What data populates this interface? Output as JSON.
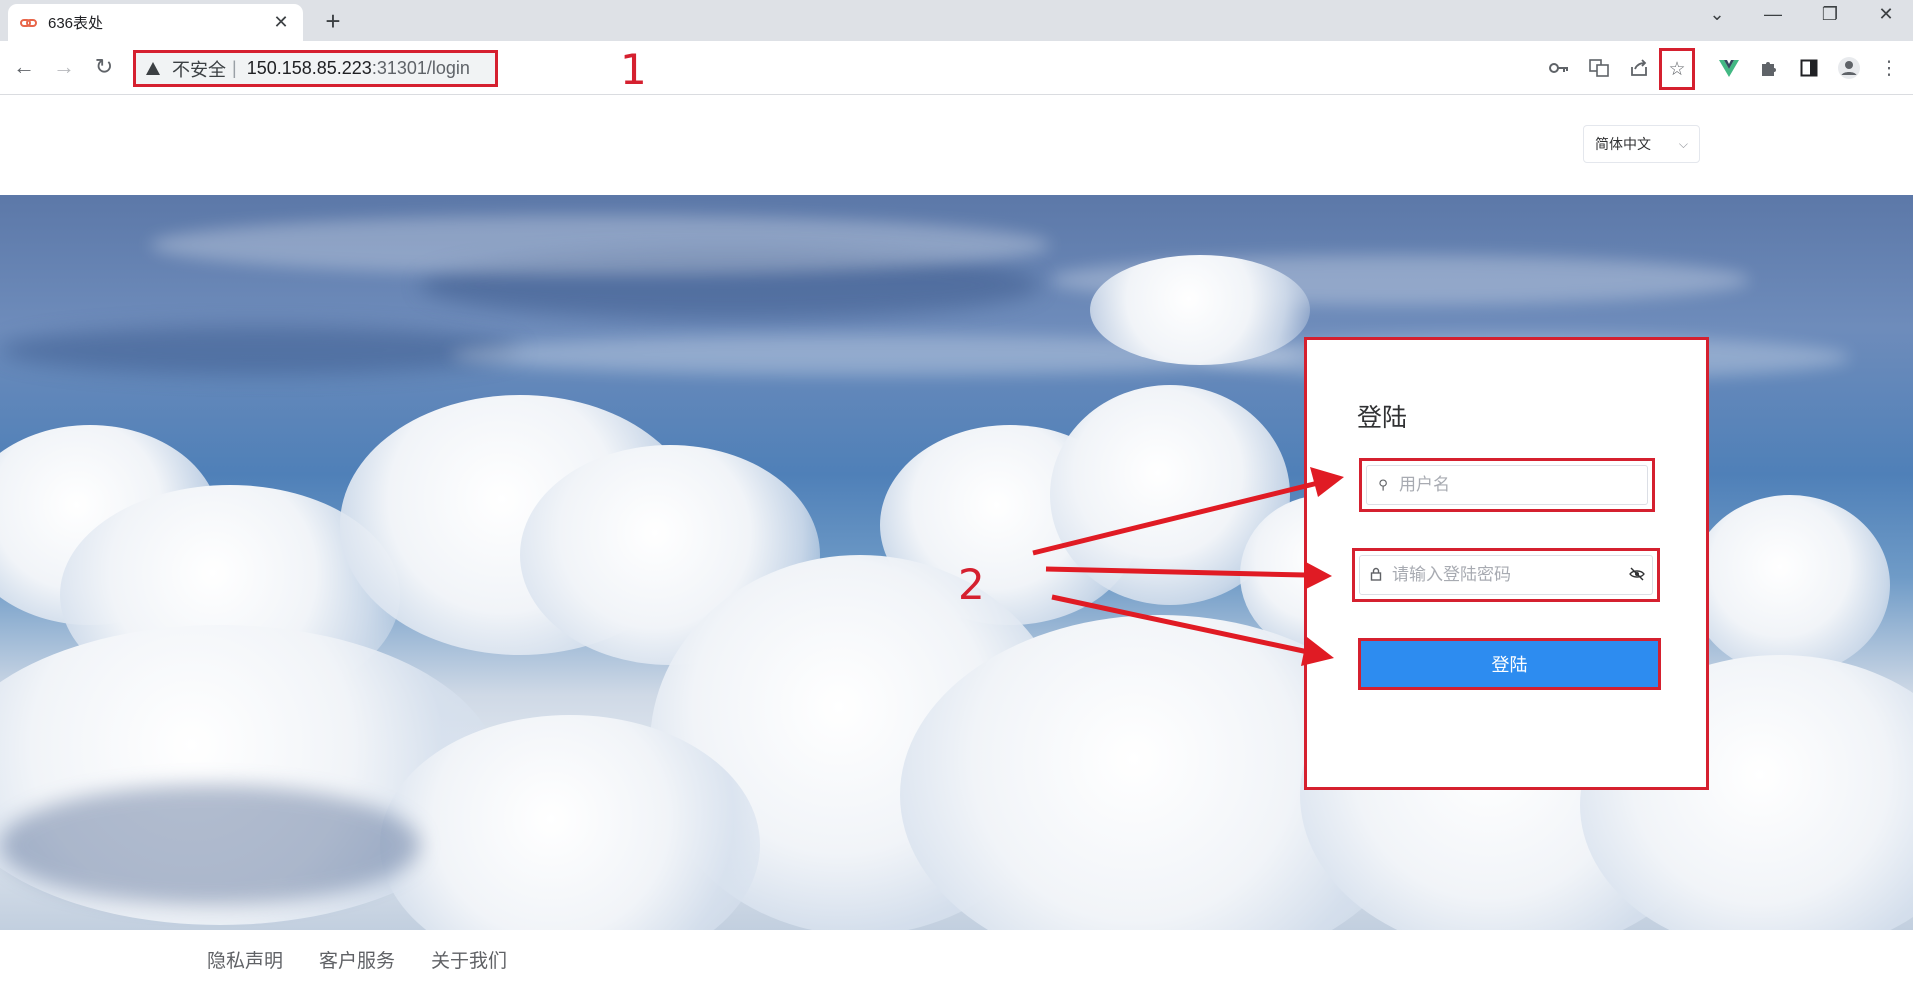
{
  "browser": {
    "tab_title": "636表处",
    "new_tab": "+",
    "tab_close": "✕",
    "address": {
      "security_label": "不安全",
      "separator": "|",
      "host": "150.158.85.223",
      "path": ":31301/login"
    },
    "annotation_1": "1"
  },
  "page": {
    "language_selector": {
      "value": "简体中文"
    },
    "login": {
      "title": "登陆",
      "username_placeholder": "用户名",
      "password_placeholder": "请输入登陆密码",
      "submit_label": "登陆"
    },
    "annotation_2": "2",
    "footer": {
      "links": [
        "隐私声明",
        "客户服务",
        "关于我们"
      ]
    }
  },
  "colors": {
    "annotation_red": "#d5202f",
    "primary_button": "#2d8cf0"
  }
}
